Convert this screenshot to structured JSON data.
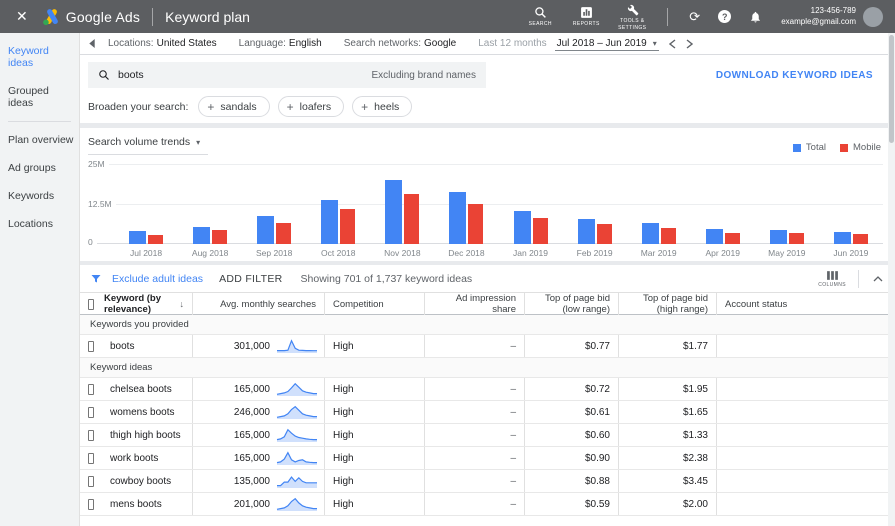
{
  "colors": {
    "accent_blue": "#4285f4",
    "bar_red": "#ea4335",
    "topbar_bg": "#5c5e61",
    "page_bg": "#e8eaed",
    "logo_yellow": "#fbbc04",
    "logo_green": "#34a853"
  },
  "topbar": {
    "close": "✕",
    "brand": "Google Ads",
    "page_title": "Keyword plan",
    "actions": [
      {
        "label": "SEARCH"
      },
      {
        "label": "REPORTS"
      },
      {
        "label": "TOOLS & SETTINGS"
      }
    ],
    "account_id": "123-456-789",
    "account_email": "example@gmail.com",
    "help_glyph": "?",
    "refresh_glyph": "⟳"
  },
  "sidebar": {
    "items": [
      {
        "label": "Keyword ideas",
        "selected": true
      },
      {
        "label": "Grouped ideas",
        "selected": false
      },
      {
        "label": "Plan overview",
        "selected": false
      },
      {
        "label": "Ad groups",
        "selected": false
      },
      {
        "label": "Keywords",
        "selected": false
      },
      {
        "label": "Locations",
        "selected": false
      }
    ]
  },
  "toolbar": {
    "locations_label": "Locations:",
    "locations_value": "United States",
    "language_label": "Language:",
    "language_value": "English",
    "networks_label": "Search networks:",
    "networks_value": "Google",
    "range_hint": "Last 12 months",
    "date_range": "Jul 2018 – Jun 2019",
    "caret": "▾"
  },
  "search": {
    "query": "boots",
    "note": "Excluding brand names",
    "download_label": "DOWNLOAD KEYWORD IDEAS"
  },
  "broaden": {
    "label": "Broaden your search:",
    "chips": [
      "sandals",
      "loafers",
      "heels"
    ],
    "plus": "+"
  },
  "chart": {
    "title": "Search volume trends",
    "caret": "▾"
  },
  "chart_data": {
    "type": "bar",
    "title": "Search volume trends",
    "categories": [
      "Jul 2018",
      "Aug 2018",
      "Sep 2018",
      "Oct 2018",
      "Nov 2018",
      "Dec 2018",
      "Jan 2019",
      "Feb 2019",
      "Mar 2019",
      "Apr 2019",
      "May 2019",
      "Jun 2019"
    ],
    "series": [
      {
        "name": "Total",
        "color": "#4285f4",
        "values": [
          4.2,
          5.5,
          8.8,
          13.8,
          20.3,
          16.3,
          10.5,
          8.0,
          6.5,
          4.6,
          4.4,
          3.8
        ]
      },
      {
        "name": "Mobile",
        "color": "#ea4335",
        "values": [
          3.0,
          4.3,
          6.8,
          11.0,
          15.8,
          12.8,
          8.2,
          6.3,
          5.2,
          3.6,
          3.4,
          3.2
        ]
      }
    ],
    "unit": "M",
    "ylim": [
      0,
      25
    ],
    "yticks": [
      "0",
      "12.5M",
      "25M"
    ],
    "grid": true,
    "legend_position": "top-right"
  },
  "filter_bar": {
    "exclude_link": "Exclude adult ideas",
    "add_filter": "ADD FILTER",
    "showing": "Showing 701 of 1,737 keyword ideas",
    "columns_label": "COLUMNS"
  },
  "table": {
    "columns": [
      "Keyword (by relevance)",
      "Avg. monthly searches",
      "Competition",
      "Ad impression share",
      "Top of page bid (low range)",
      "Top of page bid (high range)",
      "Account status"
    ],
    "sort_arrow": "↓",
    "sections": [
      {
        "label": "Keywords you provided",
        "rows": [
          {
            "keyword": "boots",
            "avg_monthly_searches": "301,000",
            "competition": "High",
            "ad_impression_share": "–",
            "bid_low": "$0.77",
            "bid_high": "$1.77",
            "account_status": "",
            "trend": [
              1,
              1,
              1,
              1.3,
              8,
              2.6,
              1.3,
              1.1,
              1,
              1,
              0.9,
              0.9
            ]
          }
        ]
      },
      {
        "label": "Keyword ideas",
        "rows": [
          {
            "keyword": "chelsea boots",
            "avg_monthly_searches": "165,000",
            "competition": "High",
            "ad_impression_share": "–",
            "bid_low": "$0.72",
            "bid_high": "$1.95",
            "account_status": "",
            "trend": [
              0.5,
              1,
              1.5,
              2.5,
              5,
              8,
              5.5,
              3,
              2,
              1.5,
              1,
              1
            ]
          },
          {
            "keyword": "womens boots",
            "avg_monthly_searches": "246,000",
            "competition": "High",
            "ad_impression_share": "–",
            "bid_low": "$0.61",
            "bid_high": "$1.65",
            "account_status": "",
            "trend": [
              0.5,
              1,
              1.5,
              3,
              6,
              8,
              5.5,
              3,
              2,
              1.5,
              1,
              1
            ]
          },
          {
            "keyword": "thigh high boots",
            "avg_monthly_searches": "165,000",
            "competition": "High",
            "ad_impression_share": "–",
            "bid_low": "$0.60",
            "bid_high": "$1.33",
            "account_status": "",
            "trend": [
              1,
              1.5,
              3,
              8,
              5.5,
              3.5,
              2.5,
              2,
              1.5,
              1.2,
              1,
              1
            ]
          },
          {
            "keyword": "work boots",
            "avg_monthly_searches": "165,000",
            "competition": "High",
            "ad_impression_share": "–",
            "bid_low": "$0.90",
            "bid_high": "$2.38",
            "account_status": "",
            "trend": [
              1,
              1.5,
              3.5,
              8,
              3,
              1.5,
              2.5,
              3,
              1.5,
              1.2,
              1,
              1
            ]
          },
          {
            "keyword": "cowboy boots",
            "avg_monthly_searches": "135,000",
            "competition": "High",
            "ad_impression_share": "–",
            "bid_low": "$0.88",
            "bid_high": "$3.45",
            "account_status": "",
            "trend": [
              1,
              1,
              3.5,
              3.5,
              7,
              4,
              6.5,
              4,
              3,
              3,
              3,
              3
            ]
          },
          {
            "keyword": "mens boots",
            "avg_monthly_searches": "201,000",
            "competition": "High",
            "ad_impression_share": "–",
            "bid_low": "$0.59",
            "bid_high": "$2.00",
            "account_status": "",
            "trend": [
              0.5,
              1,
              1.5,
              3,
              6,
              8,
              5,
              3,
              2,
              1.5,
              1,
              1
            ]
          }
        ]
      }
    ]
  }
}
